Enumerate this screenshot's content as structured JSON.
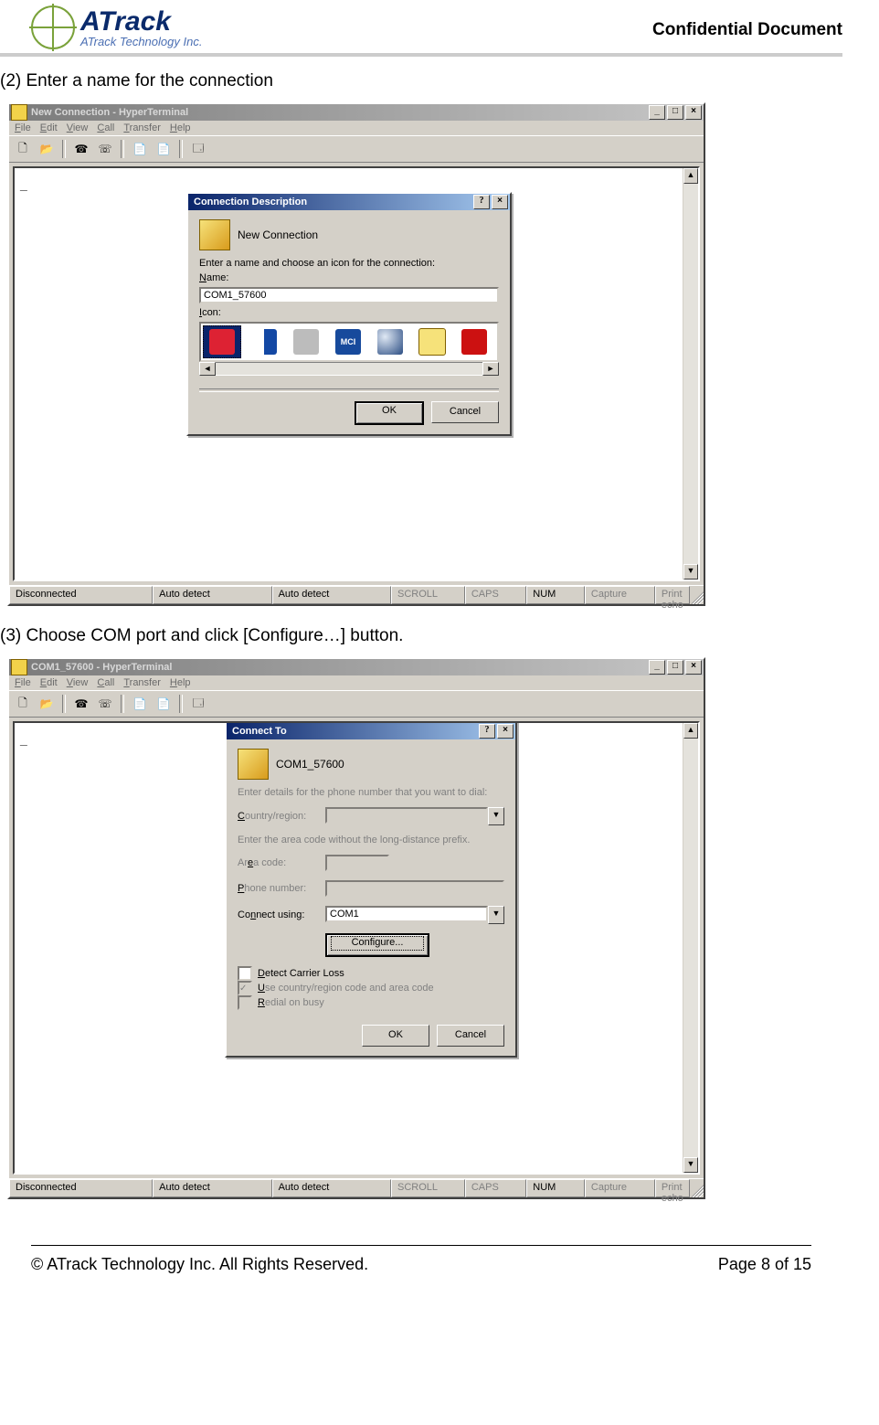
{
  "doc": {
    "brand_main": "ATrack",
    "brand_sub": "ATrack Technology Inc.",
    "confidential": "Confidential  Document",
    "footer_left": "© ATrack Technology Inc. All Rights Reserved.",
    "footer_right": "Page 8 of 15",
    "step2": "(2) Enter a name for the connection",
    "step3": "(3) Choose COM port and click [Configure…] button."
  },
  "win1": {
    "title": "New Connection - HyperTerminal",
    "menu": {
      "file": "File",
      "edit": "Edit",
      "view": "View",
      "call": "Call",
      "transfer": "Transfer",
      "help": "Help"
    },
    "status": {
      "s1": "Disconnected",
      "s2": "Auto detect",
      "s3": "Auto detect",
      "s4": "SCROLL",
      "s5": "CAPS",
      "s6": "NUM",
      "s7": "Capture",
      "s8": "Print echo"
    },
    "dialog": {
      "title": "Connection Description",
      "new_conn": "New Connection",
      "prompt": "Enter a name and choose an icon for the connection:",
      "name_label": "Name:",
      "name_value": "COM1_57600",
      "icon_label": "Icon:",
      "mci": "MCI",
      "ok": "OK",
      "cancel": "Cancel"
    }
  },
  "win2": {
    "title": "COM1_57600 - HyperTerminal",
    "menu": {
      "file": "File",
      "edit": "Edit",
      "view": "View",
      "call": "Call",
      "transfer": "Transfer",
      "help": "Help"
    },
    "status": {
      "s1": "Disconnected",
      "s2": "Auto detect",
      "s3": "Auto detect",
      "s4": "SCROLL",
      "s5": "CAPS",
      "s6": "NUM",
      "s7": "Capture",
      "s8": "Print echo"
    },
    "dialog": {
      "title": "Connect To",
      "subtitle": "COM1_57600",
      "prompt": "Enter details for the phone number that you want to dial:",
      "country_label": "Country/region:",
      "area_prompt": "Enter the area code without the long-distance prefix.",
      "area_label": "Area code:",
      "phone_label": "Phone number:",
      "connect_label": "Connect using:",
      "connect_value": "COM1",
      "configure": "Configure...",
      "chk_detect": "Detect Carrier Loss",
      "chk_use": "Use country/region code and area code",
      "chk_redial": "Redial on busy",
      "ok": "OK",
      "cancel": "Cancel"
    }
  }
}
